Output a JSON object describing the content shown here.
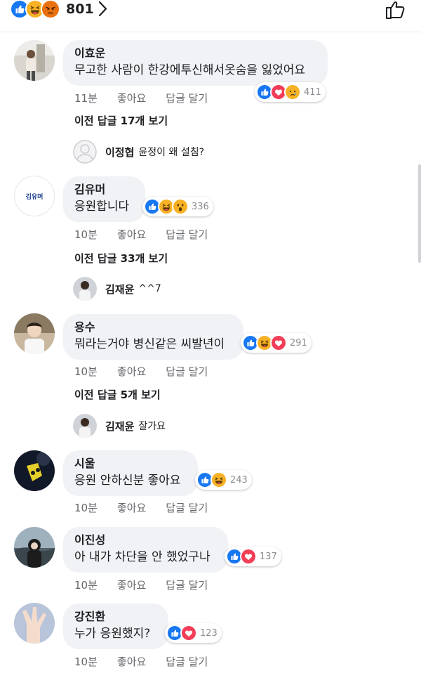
{
  "header": {
    "reactions": [
      "like-reaction",
      "haha-reaction",
      "angry-reaction"
    ],
    "count": "801",
    "chevron_icon": "chevron-right-icon",
    "like_icon": "thumbs-up-outline-icon"
  },
  "colors": {
    "like": "#1877f2",
    "love": "#f33e58",
    "emoji": "#f7b125",
    "angry": "#e9710f",
    "bubble": "#f0f2f5"
  },
  "comments": [
    {
      "author": "이효운",
      "text": "무고한 사람이 한강에투신해서옷숨을 잃었어요",
      "reactions": [
        "like-reaction",
        "love-reaction",
        "sad-reaction"
      ],
      "reaction_count": "411",
      "time": "11분",
      "like_label": "좋아요",
      "reply_label": "답글 달기",
      "view_previous": "이전 답글 17개 보기",
      "reply": {
        "name": "이정협",
        "text": "윤정이 왜 설침?"
      }
    },
    {
      "author": "김유머",
      "avatar_text": "김유머",
      "text": "응원합니다",
      "reactions": [
        "like-reaction",
        "haha-reaction",
        "wow-reaction"
      ],
      "reaction_count": "336",
      "time": "10분",
      "like_label": "좋아요",
      "reply_label": "답글 달기",
      "view_previous": "이전 답글 33개 보기",
      "reply": {
        "name": "김재윤",
        "text": "^^7"
      }
    },
    {
      "author": "용수",
      "text": "뭐라는거야 병신같은 씨발년이",
      "reactions": [
        "like-reaction",
        "haha-reaction",
        "love-reaction"
      ],
      "reaction_count": "291",
      "time": "10분",
      "like_label": "좋아요",
      "reply_label": "답글 달기",
      "view_previous": "이전 답글 5개 보기",
      "reply": {
        "name": "김재윤",
        "text": "잘가요"
      }
    },
    {
      "author": "시울",
      "text": "응원 안하신분 좋아요",
      "reactions": [
        "like-reaction",
        "haha-reaction"
      ],
      "reaction_count": "243",
      "time": "10분",
      "like_label": "좋아요",
      "reply_label": "답글 달기"
    },
    {
      "author": "이진성",
      "text": "아 내가 차단을 안 했었구나",
      "reactions": [
        "like-reaction",
        "love-reaction"
      ],
      "reaction_count": "137",
      "time": "10분",
      "like_label": "좋아요",
      "reply_label": "답글 달기"
    },
    {
      "author": "강진환",
      "text": "누가 응원했지?",
      "reactions": [
        "like-reaction",
        "love-reaction"
      ],
      "reaction_count": "123",
      "time": "10분",
      "like_label": "좋아요",
      "reply_label": "답글 달기"
    }
  ]
}
